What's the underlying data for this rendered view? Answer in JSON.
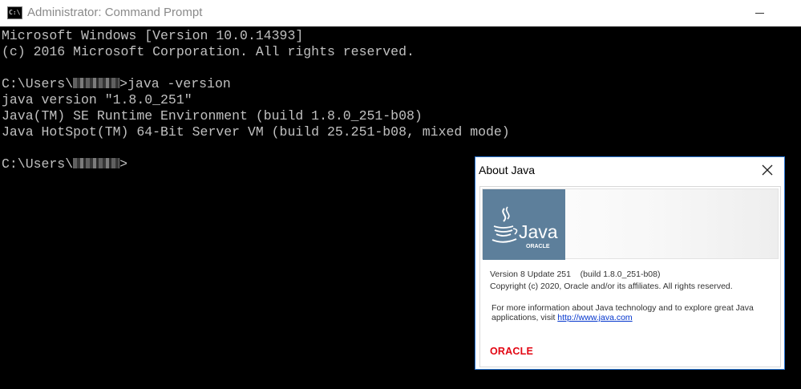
{
  "window": {
    "title": "Administrator: Command Prompt",
    "icon_label": "C:\\"
  },
  "console": {
    "line1": "Microsoft Windows [Version 10.0.14393]",
    "line2": "(c) 2016 Microsoft Corporation. All rights reserved.",
    "prompt1_prefix": "C:\\Users\\",
    "prompt1_cmd": ">java -version",
    "out1": "java version \"1.8.0_251\"",
    "out2": "Java(TM) SE Runtime Environment (build 1.8.0_251-b08)",
    "out3": "Java HotSpot(TM) 64-Bit Server VM (build 25.251-b08, mixed mode)",
    "prompt2_prefix": "C:\\Users\\",
    "prompt2_suffix": ">"
  },
  "about": {
    "title": "About Java",
    "logo_text": "Java",
    "logo_subtext": "ORACLE",
    "version": "Version 8 Update 251    (build 1.8.0_251-b08)",
    "copyright": "Copyright (c) 2020, Oracle and/or its affiliates. All rights reserved.",
    "more_info_1": "For more information about Java technology and to explore great Java",
    "more_info_2": "applications, visit ",
    "link": "http://www.java.com",
    "footer_logo": "ORACLE"
  },
  "colors": {
    "console_bg": "#000000",
    "console_fg": "#c0c0c0",
    "dialog_border": "#2b78d8",
    "java_blue": "#5d7f9b",
    "oracle_red": "#e30613",
    "link_blue": "#0033cc"
  },
  "icons": {
    "window_icon": "cmd-icon",
    "minimize": "minimize-icon",
    "close": "close-icon",
    "java_logo": "java-coffee-cup-icon"
  }
}
